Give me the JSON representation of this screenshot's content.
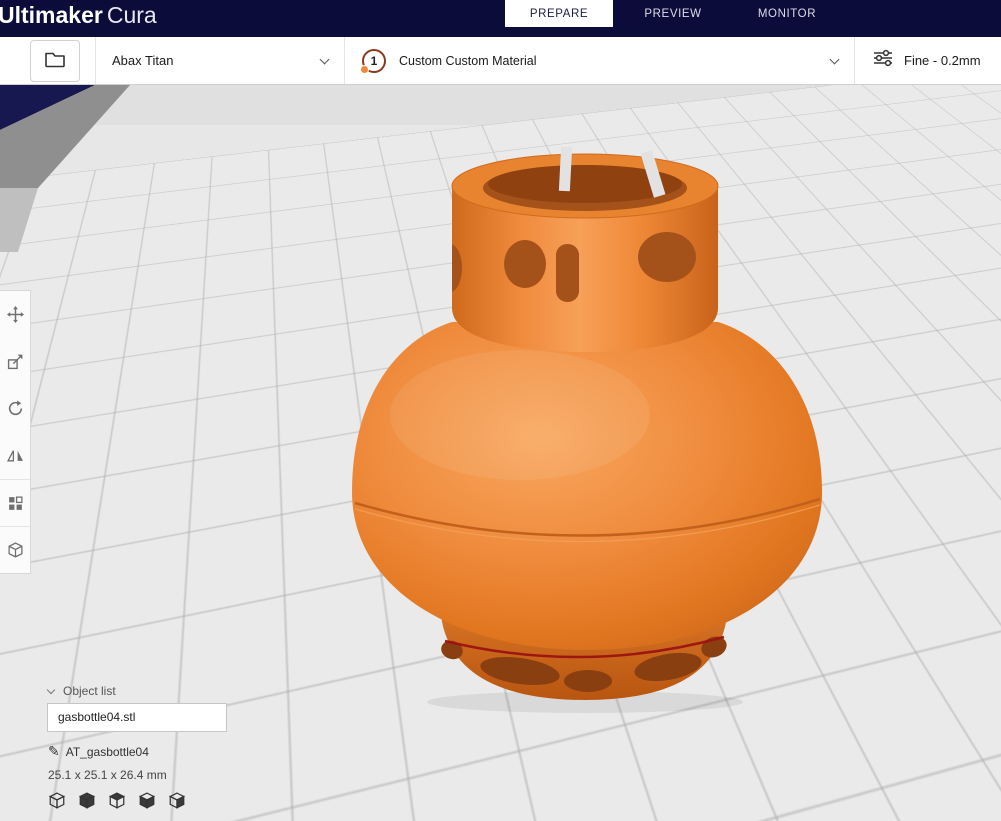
{
  "header": {
    "brand": {
      "bold": "Ultimaker",
      "light": "Cura"
    },
    "tabs": [
      {
        "label": "PREPARE",
        "active": true
      },
      {
        "label": "PREVIEW",
        "active": false
      },
      {
        "label": "MONITOR",
        "active": false
      }
    ]
  },
  "toolbar": {
    "printer": {
      "label": "Abax Titan"
    },
    "material": {
      "extruder_number": "1",
      "label": "Custom Custom Material"
    },
    "profile": {
      "label": "Fine - 0.2mm"
    }
  },
  "object_list": {
    "title": "Object list",
    "file_name": "gasbottle04.stl"
  },
  "model": {
    "name": "AT_gasbottle04",
    "dimensions": "25.1 x 25.1 x 26.4 mm",
    "color": "#ef8437"
  },
  "left_toolbar": {
    "tools": [
      "move",
      "scale",
      "rotate",
      "mirror",
      "per-model-settings",
      "support-blocker"
    ]
  },
  "bottom_icons": [
    "cube-outline",
    "cube-solid",
    "cube-top-face",
    "cube-side-faces",
    "cube-right-face"
  ],
  "colors": {
    "header_bg": "#0c0c3a",
    "accent_orange": "#f08a3a",
    "viewport_bg": "#e9e9e9",
    "seam_red": "#9c1212"
  }
}
